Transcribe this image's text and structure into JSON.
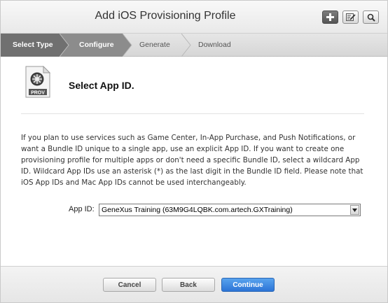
{
  "header": {
    "title": "Add iOS Provisioning Profile",
    "buttons": [
      {
        "icon": "plus-icon"
      },
      {
        "icon": "edit-icon"
      },
      {
        "icon": "search-icon"
      }
    ]
  },
  "steps": [
    {
      "label": "Select Type",
      "state": "done"
    },
    {
      "label": "Configure",
      "state": "active"
    },
    {
      "label": "Generate",
      "state": "todo"
    },
    {
      "label": "Download",
      "state": "todo"
    }
  ],
  "content": {
    "icon": {
      "name": "provisioning-profile-icon",
      "label": "PROV"
    },
    "section_title": "Select App ID.",
    "description": "If you plan to use services such as Game Center, In-App Purchase, and Push Notifications, or want a Bundle ID unique to a single app, use an explicit App ID. If you want to create one provisioning profile for multiple apps or don't need a specific Bundle ID, select a wildcard App ID. Wildcard App IDs use an asterisk (*) as the last digit in the Bundle ID field. Please note that iOS App IDs and Mac App IDs cannot be used interchangeably.",
    "app_id": {
      "label": "App ID:",
      "selected": "GeneXus Training (63M9G4LQBK.com.artech.GXTraining)"
    }
  },
  "footer": {
    "cancel_label": "Cancel",
    "back_label": "Back",
    "continue_label": "Continue"
  },
  "colors": {
    "primary_button": "#2c74d6",
    "step_done": "#707070",
    "step_active": "#8c8c8c"
  }
}
